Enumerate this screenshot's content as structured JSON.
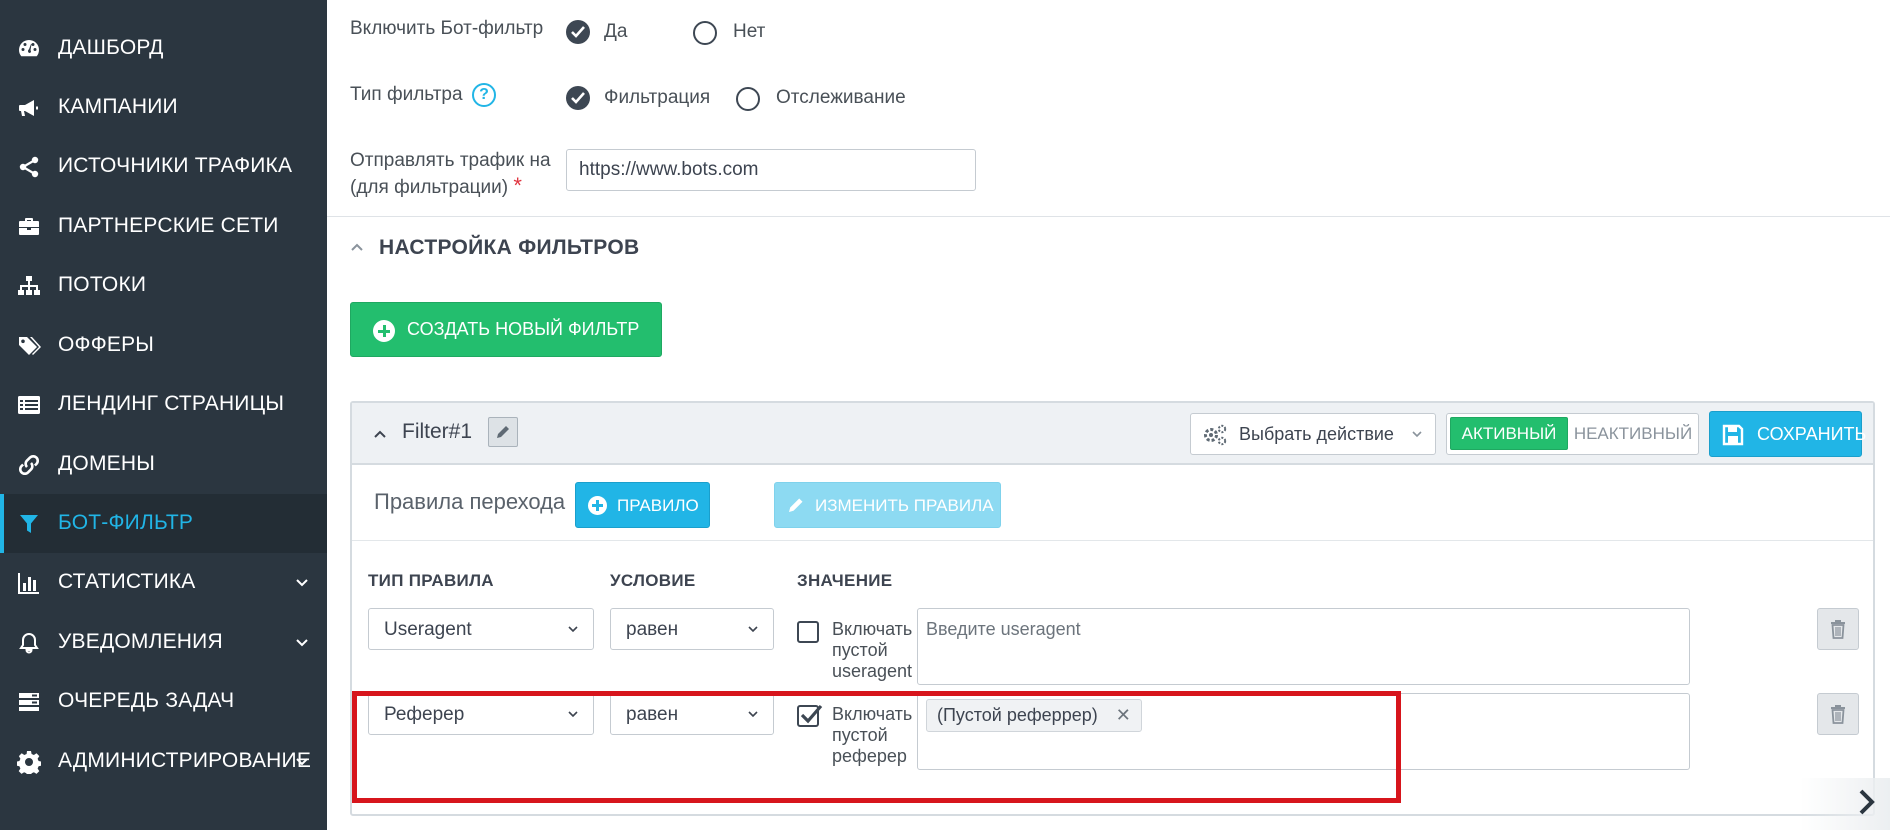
{
  "sidebar": {
    "items": [
      {
        "label": "ДАШБОРД",
        "icon": "dashboard-icon"
      },
      {
        "label": "КАМПАНИИ",
        "icon": "megaphone-icon"
      },
      {
        "label": "ИСТОЧНИКИ ТРАФИКА",
        "icon": "share-icon"
      },
      {
        "label": "ПАРТНЕРСКИЕ СЕТИ",
        "icon": "briefcase-icon"
      },
      {
        "label": "ПОТОКИ",
        "icon": "sitemap-icon"
      },
      {
        "label": "ОФФЕРЫ",
        "icon": "tags-icon"
      },
      {
        "label": "ЛЕНДИНГ СТРАНИЦЫ",
        "icon": "list-icon"
      },
      {
        "label": "ДОМЕНЫ",
        "icon": "link-icon"
      },
      {
        "label": "БОТ-ФИЛЬТР",
        "icon": "filter-icon",
        "active": true
      },
      {
        "label": "СТАТИСТИКА",
        "icon": "bar-chart-icon",
        "expandable": true
      },
      {
        "label": "УВЕДОМЛЕНИЯ",
        "icon": "bell-icon",
        "expandable": true
      },
      {
        "label": "ОЧЕРЕДЬ ЗАДАЧ",
        "icon": "server-icon"
      },
      {
        "label": "АДМИНИСТРИРОВАНИЕ",
        "icon": "gear-icon",
        "expandable": true
      }
    ],
    "active_color": "#21b5e6"
  },
  "form": {
    "enable_label": "Включить Бот-фильтр",
    "enable_yes": "Да",
    "enable_no": "Нет",
    "type_label": "Тип фильтра",
    "type_filter": "Фильтрация",
    "type_track": "Отслеживание",
    "send_label_1": "Отправлять трафик на",
    "send_label_2": "(для фильтрации)",
    "required_mark": "*",
    "send_url": "https://www.bots.com"
  },
  "section": {
    "title": "НАСТРОЙКА ФИЛЬТРОВ",
    "create_button": "СОЗДАТЬ НОВЫЙ ФИЛЬТР"
  },
  "filter": {
    "name": "Filter#1",
    "action_select": "Выбрать действие",
    "active_label": "АКТИВНЫЙ",
    "inactive_label": "НЕАКТИВНЫЙ",
    "save_button": "СОХРАНИТЬ",
    "rules_label": "Правила перехода",
    "rule_button": "ПРАВИЛО",
    "edit_rules_button": "ИЗМЕНИТЬ ПРАВИЛА",
    "columns": {
      "type": "ТИП ПРАВИЛА",
      "condition": "УСЛОВИЕ",
      "value": "ЗНАЧЕНИЕ"
    },
    "rules": [
      {
        "type": "Useragent",
        "condition": "равен",
        "include_empty": false,
        "include_label": [
          "Включать",
          "пустой",
          "useragent"
        ],
        "value_placeholder": "Введите useragent",
        "tags": []
      },
      {
        "type": "Реферер",
        "condition": "равен",
        "include_empty": true,
        "include_label": [
          "Включать",
          "пустой",
          "реферер"
        ],
        "value_placeholder": "",
        "tags": [
          "(Пустой реферрер)"
        ]
      }
    ]
  },
  "colors": {
    "green": "#23be6e",
    "blue": "#21b5e6",
    "highlight_red": "#d7151c"
  }
}
